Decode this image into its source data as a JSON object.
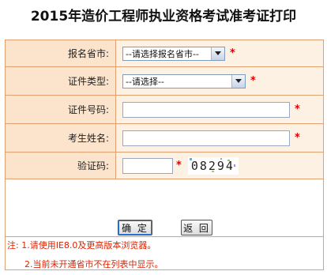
{
  "page": {
    "title": "2015年造价工程师执业资格考试准考证打印"
  },
  "form": {
    "province": {
      "label": "报名省市:",
      "selected": "--请选择报名省市--",
      "required_mark": "*"
    },
    "id_type": {
      "label": "证件类型:",
      "selected": "--请选择--",
      "required_mark": "*"
    },
    "id_number": {
      "label": "证件号码:",
      "value": "",
      "required_mark": "*"
    },
    "name": {
      "label": "考生姓名:",
      "value": "",
      "required_mark": "*"
    },
    "captcha": {
      "label": "验证码:",
      "value": "",
      "required_mark": "*",
      "image_text": "08294"
    }
  },
  "buttons": {
    "confirm_label": "确 定",
    "back_label": "返 回"
  },
  "notes": {
    "line1": "注: 1.请使用IE8.0及更高版本浏览器。",
    "line2": "2.当前未开通省市不在列表中显示。"
  },
  "colors": {
    "label_bg": "#fce4cc",
    "value_bg": "#fdf1e4",
    "border": "#e0a070",
    "required": "#e00000",
    "note_text": "#dd2200"
  },
  "icons": {
    "dropdown": "chevron-down-icon"
  }
}
